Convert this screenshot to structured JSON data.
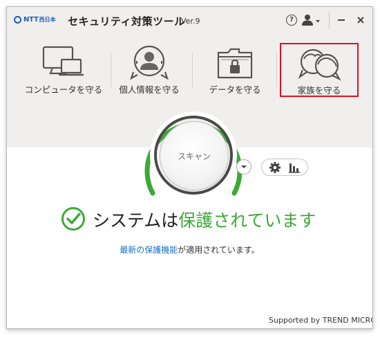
{
  "window": {
    "logo_text": "NTT",
    "logo_sub": "西日本",
    "title": "セキュリティ対策ツール",
    "version": "Ver.9",
    "help_label": "?"
  },
  "nav": [
    {
      "label": "コンピュータを守る",
      "icon": "computer-icon"
    },
    {
      "label": "個人情報を守る",
      "icon": "person-icon"
    },
    {
      "label": "データを守る",
      "icon": "folder-lock-icon"
    },
    {
      "label": "家族を守る",
      "icon": "family-icon",
      "highlighted": true
    }
  ],
  "scan": {
    "button_label": "スキャン"
  },
  "status": {
    "text_normal": "システムは",
    "text_green": "保護されています",
    "sub_link": "最新の保護機能",
    "sub_rest": "が適用されています。"
  },
  "footer": {
    "supported": "Supported by TREND MICRO"
  },
  "colors": {
    "green": "#3aaa35",
    "link": "#1a6fc4",
    "highlight_border": "#e01020",
    "brand": "#1a5fb4"
  }
}
